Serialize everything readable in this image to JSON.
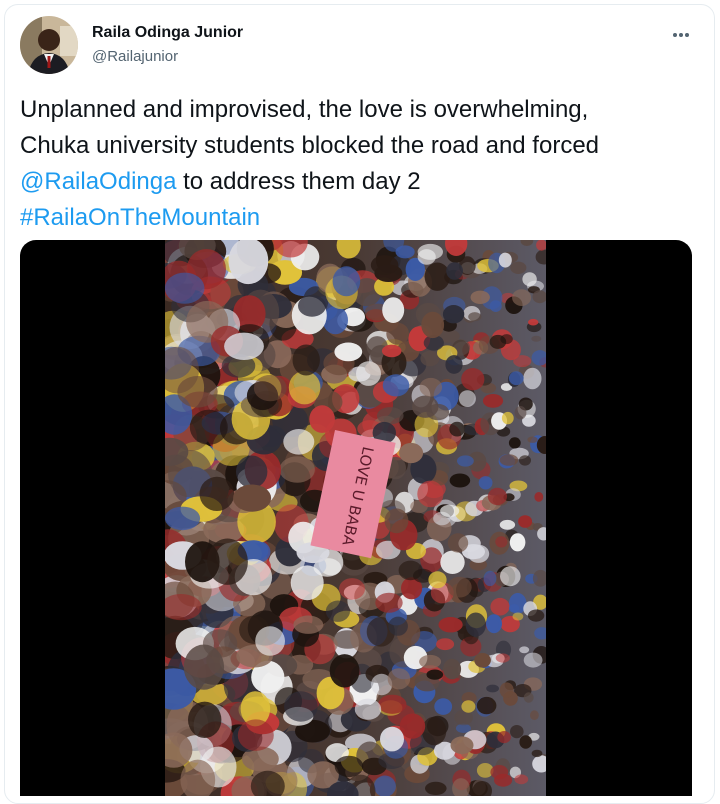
{
  "tweet": {
    "author_name": "Raila Odinga Junior",
    "author_handle": "@Railajunior",
    "more_icon": "more-horizontal-icon",
    "text_line1": "Unplanned and improvised, the love is overwhelming,",
    "text_line2": "Chuka university students blocked the road and forced",
    "mention": "@RailaOdinga",
    "text_line3_rest": " to address them day 2",
    "hashtag": "#RailaOnTheMountain",
    "media_type": "video",
    "placard_text": "LOVE U BABA"
  },
  "colors": {
    "link": "#1d9bf0",
    "text": "#0f1419",
    "secondary": "#536471",
    "border": "#e6ecf0",
    "media_bg": "#000000"
  }
}
